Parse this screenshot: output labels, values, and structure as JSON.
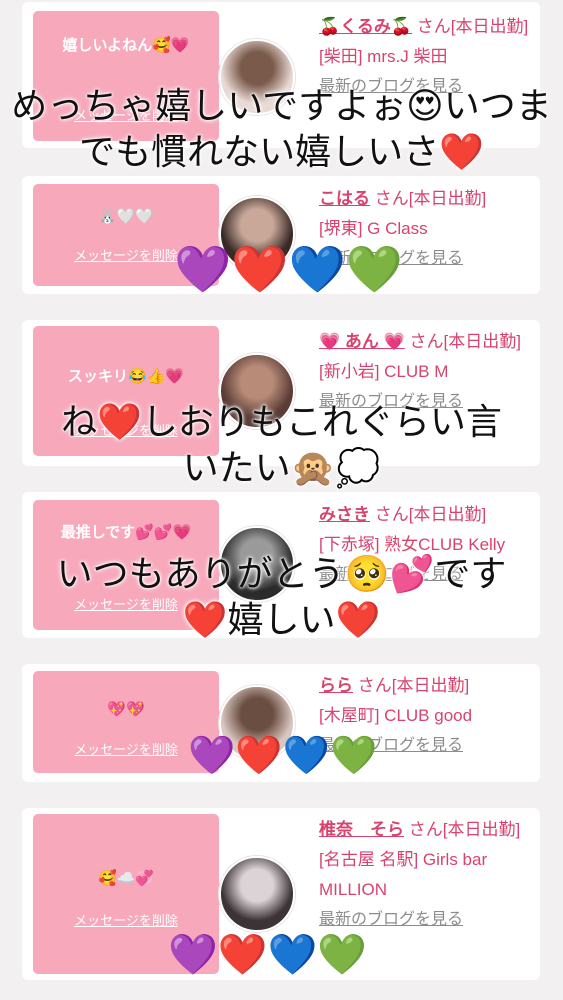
{
  "cards": [
    {
      "message": "嬉しいよねん🥰💗",
      "delete_label": "メッセージを削除",
      "name": "🍒くるみ🍒",
      "san_label": "さん[本日出勤]",
      "shop": "[柴田] mrs.J 柴田",
      "blog_label": "最新のブログを見る",
      "avatar_colors": [
        "#e9d9d5",
        "#7a5a4a"
      ]
    },
    {
      "message": "🐰🤍🤍",
      "delete_label": "メッセージを削除",
      "name": "こはる",
      "san_label": "さん[本日出勤]",
      "shop": "[堺東] G Class",
      "blog_label": "最新のブログを見る",
      "avatar_colors": [
        "#3a2a26",
        "#c9a89a"
      ]
    },
    {
      "message": "スッキリ😂👍💗",
      "delete_label": "メッセージを削除",
      "name": "💗 あん 💗",
      "san_label": "さん[本日出勤]",
      "shop": "[新小岩] CLUB M",
      "blog_label": "最新のブログを見る",
      "avatar_colors": [
        "#5a3b36",
        "#b78b77"
      ]
    },
    {
      "message": "最推しです💕💕💗",
      "delete_label": "メッセージを削除",
      "name": "みさき",
      "san_label": "さん[本日出勤]",
      "shop": "[下赤塚] 熟女CLUB Kelly",
      "blog_label": "最新のブログを見る",
      "avatar_colors": [
        "#2a2a2a",
        "#9a9a9a"
      ]
    },
    {
      "message": "💖💖",
      "delete_label": "メッセージを削除",
      "name": "らら",
      "san_label": "さん[本日出勤]",
      "shop": "[木屋町] CLUB good",
      "blog_label": "最新のブログを見る",
      "avatar_colors": [
        "#d9c6bf",
        "#6b4e42"
      ]
    },
    {
      "message": "🥰☁️💞",
      "delete_label": "メッセージを削除",
      "name": "椎奈　そら",
      "san_label": "さん[本日出勤]",
      "shop": "[名古屋 名駅] Girls bar MILLION",
      "blog_label": "最新のブログを見る",
      "avatar_colors": [
        "#3b3336",
        "#dcd3d6"
      ]
    }
  ],
  "overlays": {
    "caption1_line1": "めっちゃ嬉しいですよぉ😍いつま",
    "caption1_line2": "でも慣れない嬉しいさ❤️",
    "caption2_line1": "ね❤️しおりもこれぐらい言",
    "caption2_line2": "いたい🙊💭",
    "caption3_line1": "いつもありがとう🥺💕です",
    "caption3_line2": "❤️嬉しい❤️",
    "hearts": "💜❤️💙💚"
  },
  "colors": {
    "bubble": "#f7a8bb",
    "accent": "#d8436e",
    "background": "#f3f0f1"
  }
}
